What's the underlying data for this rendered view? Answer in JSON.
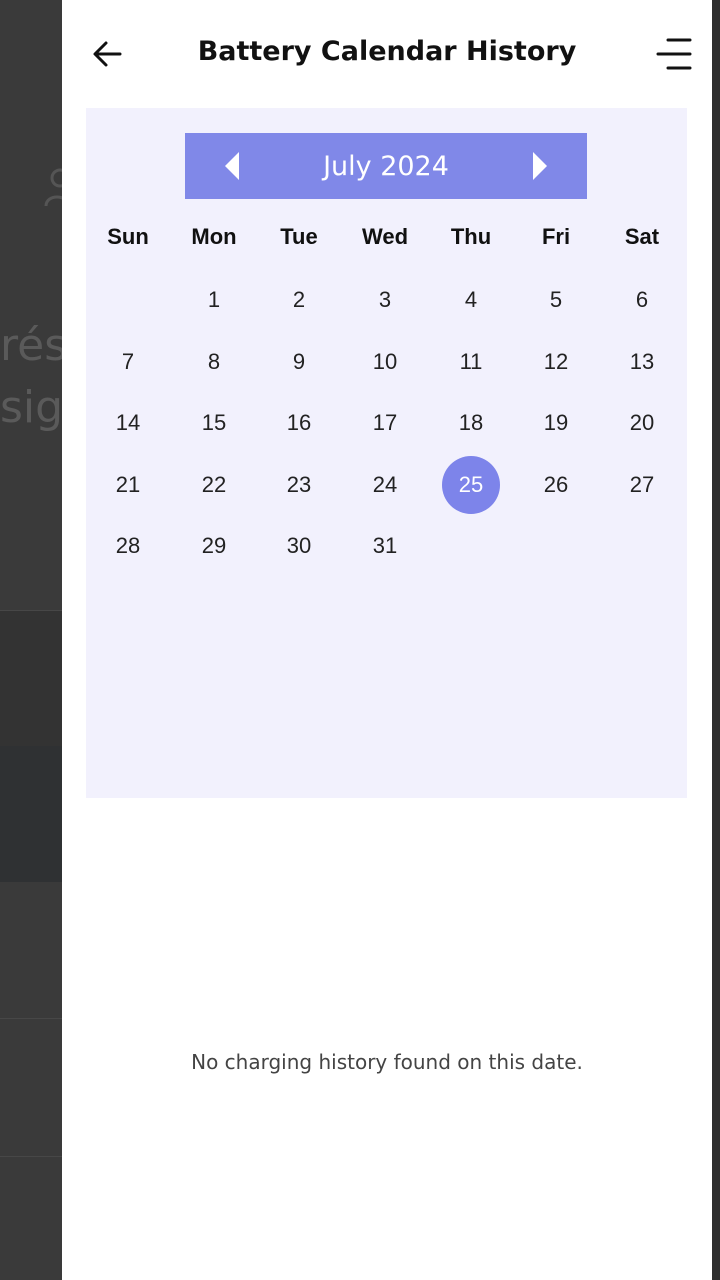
{
  "header": {
    "title": "Battery Calendar History",
    "back_icon": "arrow-left-icon",
    "menu_icon": "menu-icon"
  },
  "calendar": {
    "month_label": "July 2024",
    "prev_icon": "triangle-left-icon",
    "next_icon": "triangle-right-icon",
    "weekdays": [
      "Sun",
      "Mon",
      "Tue",
      "Wed",
      "Thu",
      "Fri",
      "Sat"
    ],
    "first_weekday_index": 1,
    "days_in_month": 31,
    "selected_day": "25",
    "days": [
      "1",
      "2",
      "3",
      "4",
      "5",
      "6",
      "7",
      "8",
      "9",
      "10",
      "11",
      "12",
      "13",
      "14",
      "15",
      "16",
      "17",
      "18",
      "19",
      "20",
      "21",
      "22",
      "23",
      "24",
      "25",
      "26",
      "27",
      "28",
      "29",
      "30",
      "31"
    ],
    "accent_color": "#7d84ea",
    "background_color": "#f2f1fd"
  },
  "empty_state": {
    "message": "No charging history found on this date."
  },
  "background_app": {
    "fragment_1": "rés",
    "fragment_2": "sig"
  }
}
